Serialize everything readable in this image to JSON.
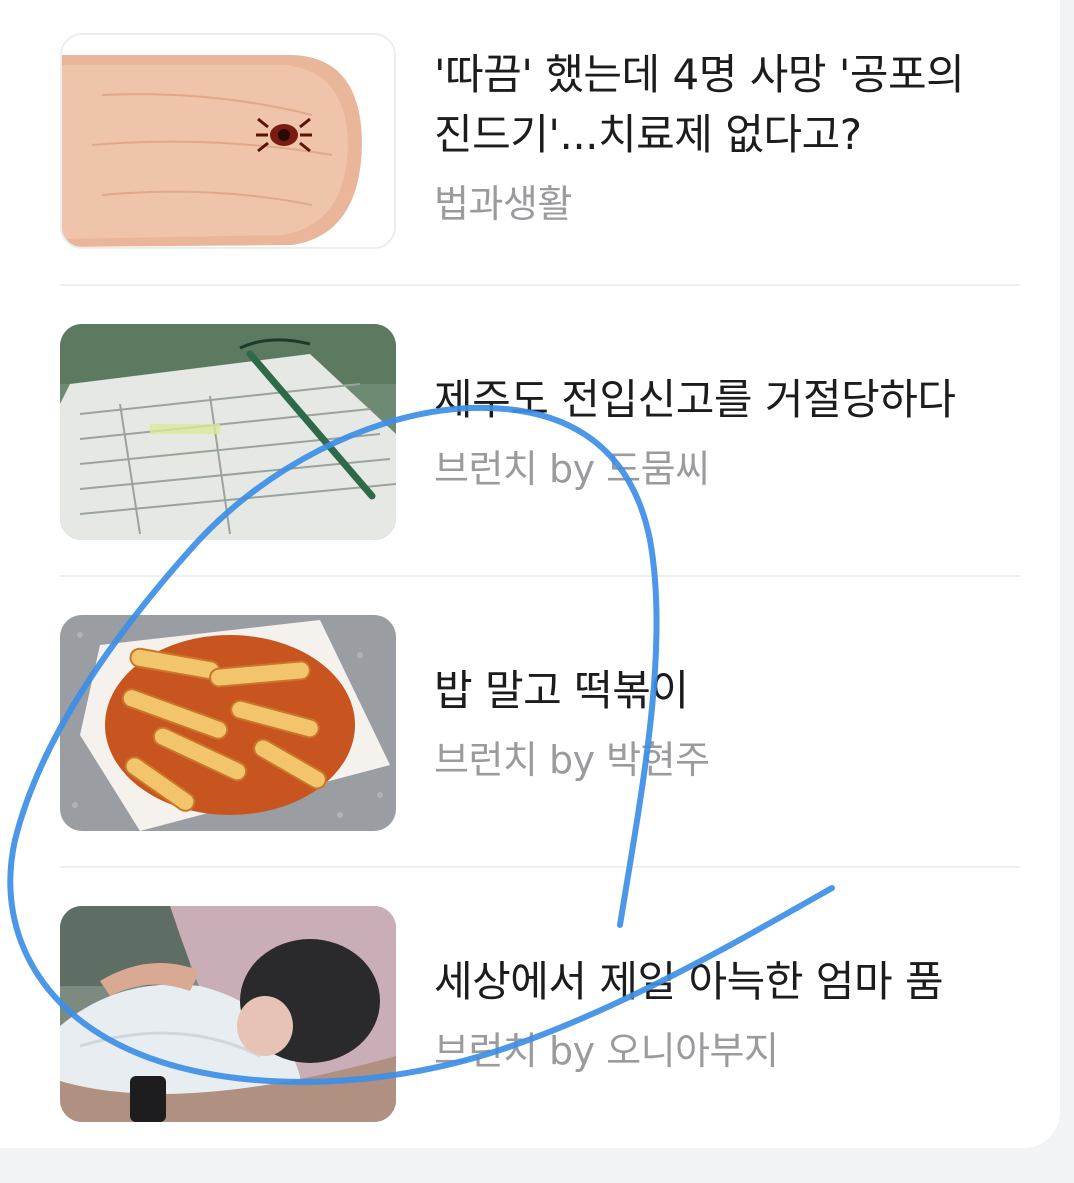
{
  "articles": [
    {
      "title_line1": "'따끔' 했는데 4명 사망 '공포의",
      "title_line2": "진드기'...치료제 없다고?",
      "source": "법과생활",
      "thumbnail_icon": "tick-on-fingertip-image"
    },
    {
      "title_line1": "제주도 전입신고를 거절당하다",
      "source": "브런치 by 드뭄씨",
      "thumbnail_icon": "registration-form-with-pen-image"
    },
    {
      "title_line1": "밥 말고 떡볶이",
      "source": "브런치 by 박현주",
      "thumbnail_icon": "tteokbokki-plate-image"
    },
    {
      "title_line1": "세상에서 제일 아늑한 엄마 품",
      "source": "브런치 by 오니아부지",
      "thumbnail_icon": "baby-in-mother-arms-image"
    }
  ],
  "colors": {
    "title": "#1c1c1e",
    "source": "#9b9b9f",
    "divider": "#eeeff1",
    "scribble": "#3d8ee6"
  }
}
